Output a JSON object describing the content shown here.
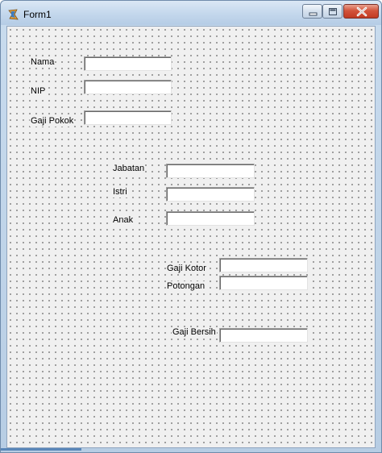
{
  "window": {
    "title": "Form1",
    "icon": "delphi-app-icon",
    "controls": {
      "minimize_icon": "minimize-icon",
      "maximize_icon": "maximize-icon",
      "close_icon": "close-icon"
    }
  },
  "form": {
    "nama": {
      "label": "Nama",
      "value": ""
    },
    "nip": {
      "label": "NIP",
      "value": ""
    },
    "gaji_pokok": {
      "label": "Gaji Pokok",
      "value": ""
    },
    "jabatan": {
      "label": "Jabatan",
      "value": ""
    },
    "istri": {
      "label": "Istri",
      "value": ""
    },
    "anak": {
      "label": "Anak",
      "value": ""
    },
    "gaji_kotor": {
      "label": "Gaji Kotor",
      "value": ""
    },
    "potongan": {
      "label": "Potongan",
      "value": ""
    },
    "gaji_bersih": {
      "label": "Gaji Bersih",
      "value": ""
    }
  },
  "colors": {
    "titlebar": "#c3d7ec",
    "close_button": "#c13a22",
    "form_background": "#f0f0f0",
    "grid_dots": "#555555"
  }
}
